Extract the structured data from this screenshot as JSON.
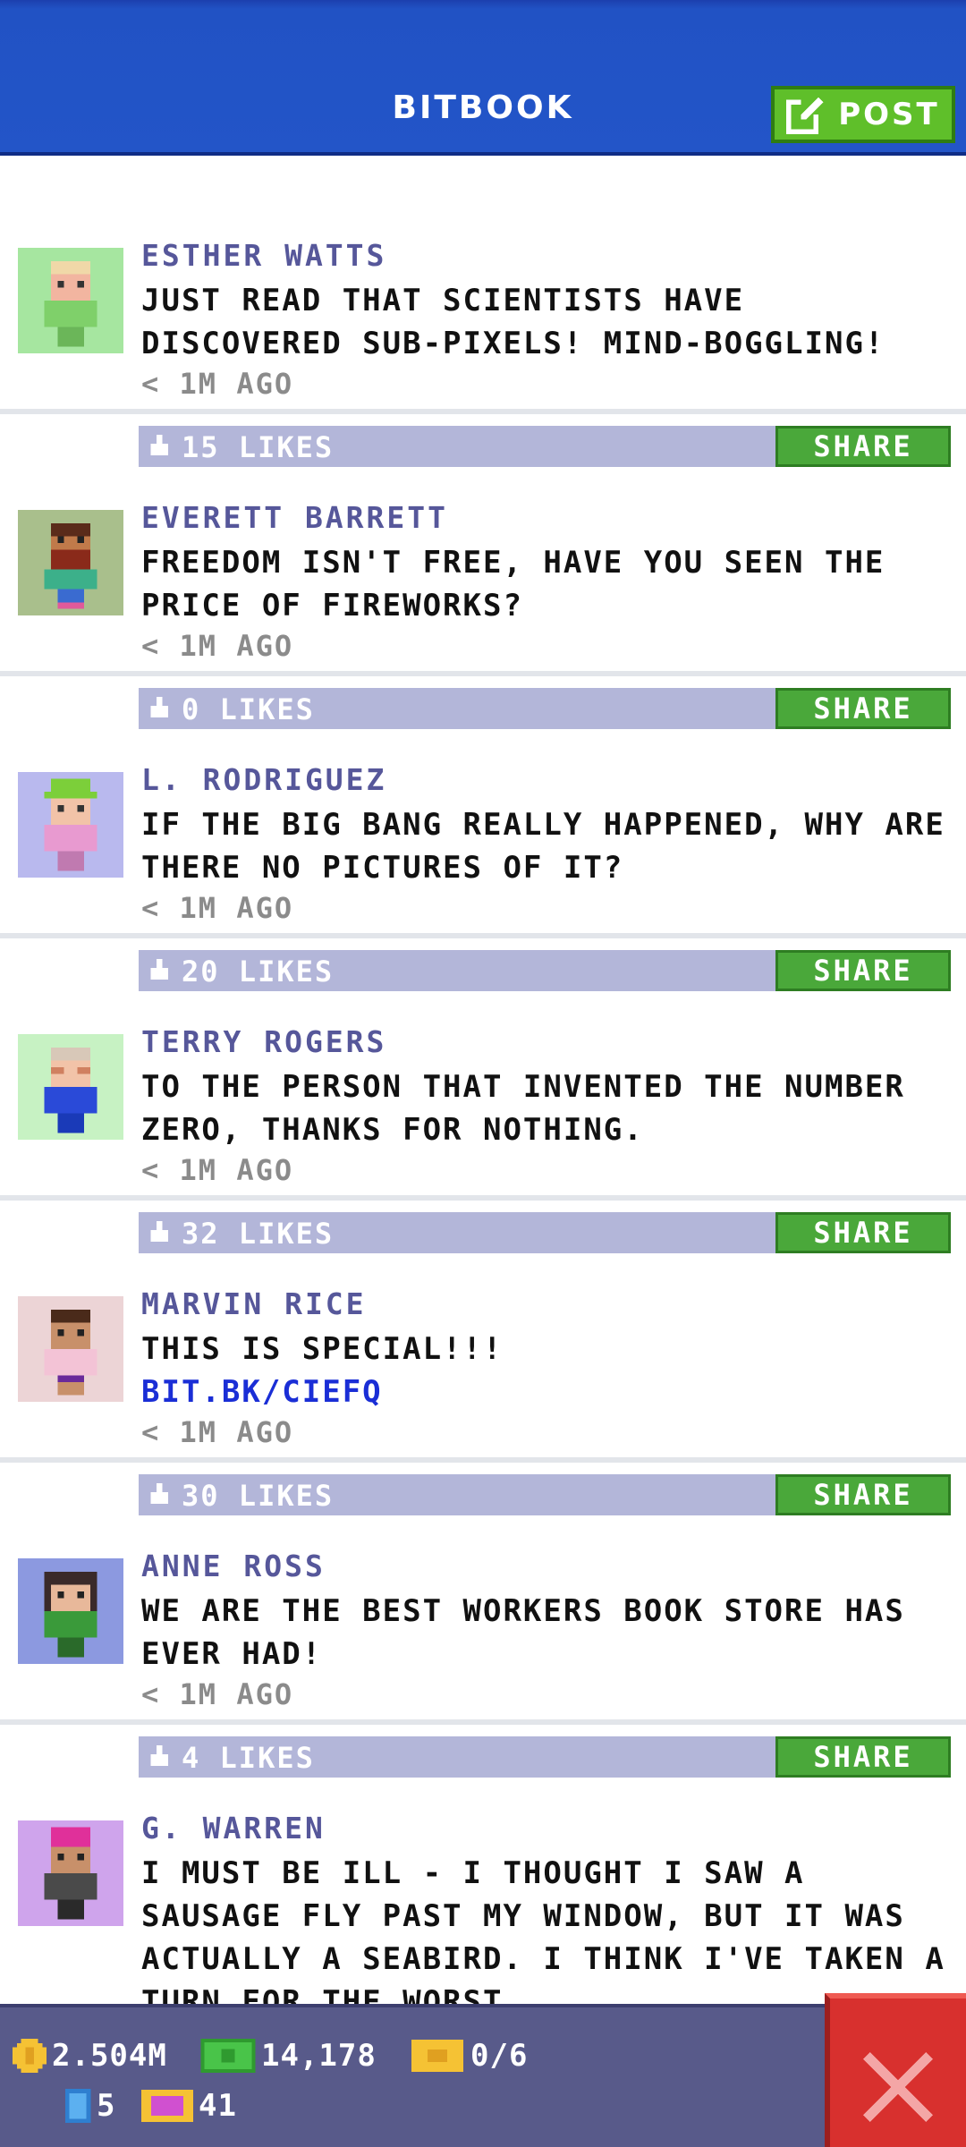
{
  "header": {
    "title": "BITBOOK",
    "post_label": "POST"
  },
  "posts": [
    {
      "name": "ESTHER WATTS",
      "text": "JUST READ THAT SCIENTISTS HAVE DISCOVERED SUB-PIXELS! MIND-BOGGLING!",
      "link": "",
      "time": "< 1M AGO",
      "likes": "15 LIKES",
      "share": "SHARE",
      "avatar_bg": "#a6e6a0",
      "avatar": "esther-watts-avatar"
    },
    {
      "name": "EVERETT BARRETT",
      "text": "FREEDOM ISN'T FREE, HAVE YOU SEEN THE PRICE OF FIREWORKS?",
      "link": "",
      "time": "< 1M AGO",
      "likes": "0 LIKES",
      "share": "SHARE",
      "avatar_bg": "#a9bf8c",
      "avatar": "everett-barrett-avatar"
    },
    {
      "name": "L. RODRIGUEZ",
      "text": "IF THE BIG BANG REALLY HAPPENED, WHY ARE THERE NO PICTURES OF IT?",
      "link": "",
      "time": "< 1M AGO",
      "likes": "20 LIKES",
      "share": "SHARE",
      "avatar_bg": "#b9b9ee",
      "avatar": "l-rodriguez-avatar"
    },
    {
      "name": "TERRY ROGERS",
      "text": "TO THE PERSON THAT INVENTED THE NUMBER ZERO, THANKS FOR NOTHING.",
      "link": "",
      "time": "< 1M AGO",
      "likes": "32 LIKES",
      "share": "SHARE",
      "avatar_bg": "#c7f2c3",
      "avatar": "terry-rogers-avatar"
    },
    {
      "name": "MARVIN RICE",
      "text": "THIS IS SPECIAL!!!",
      "link": "BIT.BK/CIEFQ",
      "time": "< 1M AGO",
      "likes": "30 LIKES",
      "share": "SHARE",
      "avatar_bg": "#ecd4d6",
      "avatar": "marvin-rice-avatar"
    },
    {
      "name": "ANNE ROSS",
      "text": "WE ARE THE BEST WORKERS BOOK STORE HAS EVER HAD!",
      "link": "",
      "time": "< 1M AGO",
      "likes": "4 LIKES",
      "share": "SHARE",
      "avatar_bg": "#8c99e0",
      "avatar": "anne-ross-avatar"
    },
    {
      "name": "G. WARREN",
      "text": "I MUST BE ILL - I THOUGHT I SAW A SAUSAGE FLY PAST MY WINDOW, BUT IT WAS ACTUALLY A SEABIRD. I THINK I'VE TAKEN A TURN FOR THE WORST.",
      "link": "",
      "time": "",
      "likes": "",
      "share": "",
      "avatar_bg": "#cfa4ec",
      "avatar": "g-warren-avatar"
    }
  ],
  "status": {
    "coins": "2.504M",
    "cash": "14,178",
    "tickets": "0/6",
    "bux": "5",
    "vip": "41"
  },
  "colors": {
    "header_blue": "#2355c8",
    "post_green": "#5fbf2a",
    "name_purple": "#56579a",
    "like_bar": "#b3b6d9",
    "share_green": "#4aa83a",
    "link_blue": "#1a2ed6",
    "status_bar": "#585a8a",
    "close_red": "#d8302e"
  }
}
